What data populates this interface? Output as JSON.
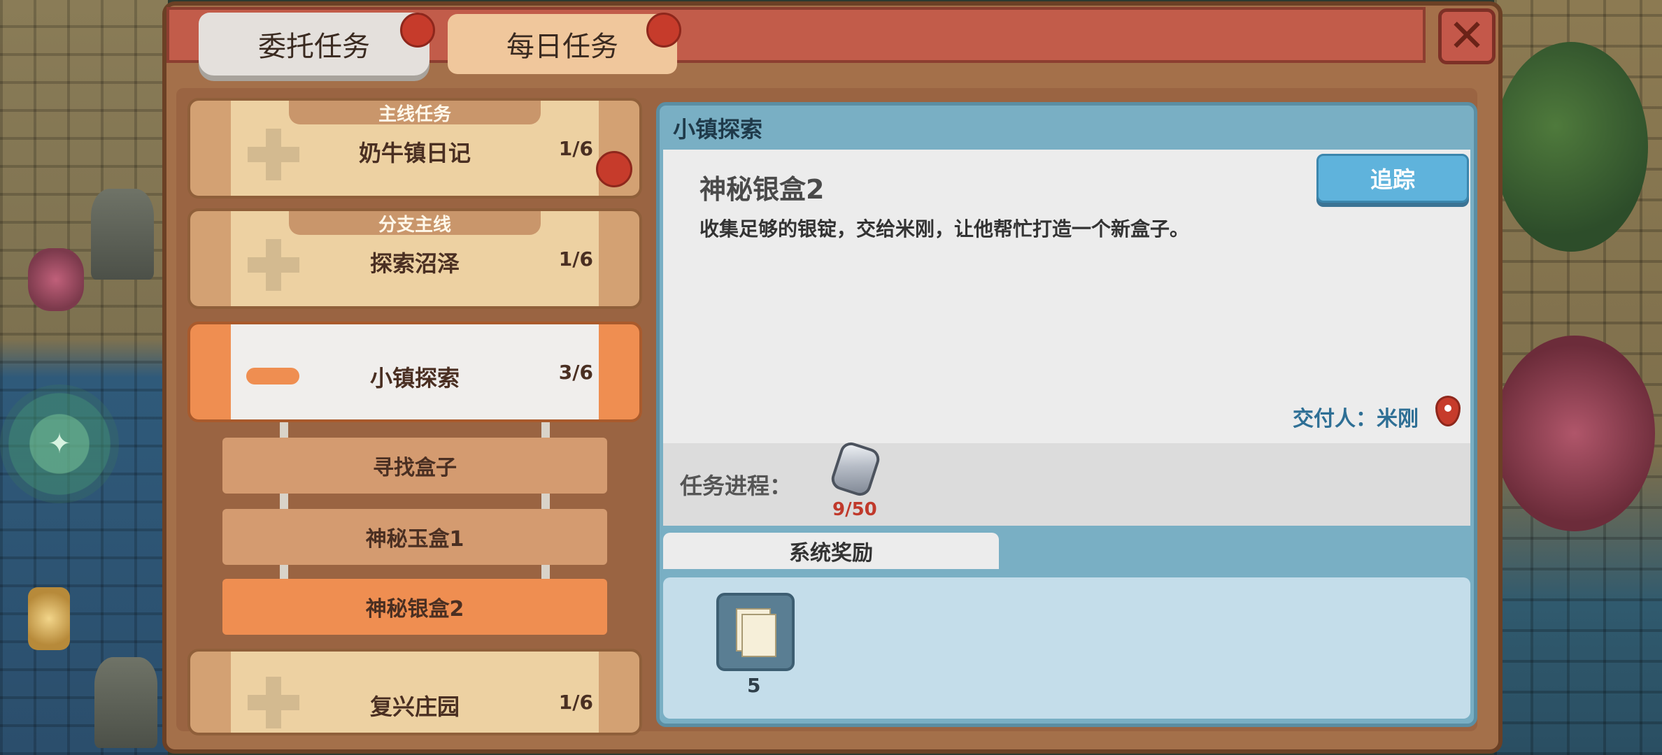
{
  "tabs": {
    "commission": "委托任务",
    "daily": "每日任务"
  },
  "close": "✕",
  "categories": [
    {
      "tag": "主线任务",
      "title": "奶牛镇日记",
      "progress": "1/6"
    },
    {
      "tag": "分支主线",
      "title": "探索沼泽",
      "progress": "1/6"
    },
    {
      "tag": "",
      "title": "小镇探索",
      "progress": "3/6"
    },
    {
      "tag": "",
      "title": "复兴庄园",
      "progress": "1/6"
    }
  ],
  "subquests": [
    "寻找盒子",
    "神秘玉盒1",
    "神秘银盒2"
  ],
  "detail": {
    "header": "小镇探索",
    "quest_title": "神秘银盒2",
    "description": "收集足够的银锭，交给米刚，让他帮忙打造一个新盒子。",
    "track_button": "追踪",
    "giver": "交付人：米刚",
    "progress_label": "任务进程：",
    "progress_count": "9/50",
    "reward_tab": "系统奖励",
    "reward_count": "5"
  },
  "colors": {
    "accent_orange": "#ef8e51",
    "tab_red": "#c25c4a",
    "badge_red": "#c63b2b",
    "track_blue": "#5fb3dc"
  }
}
